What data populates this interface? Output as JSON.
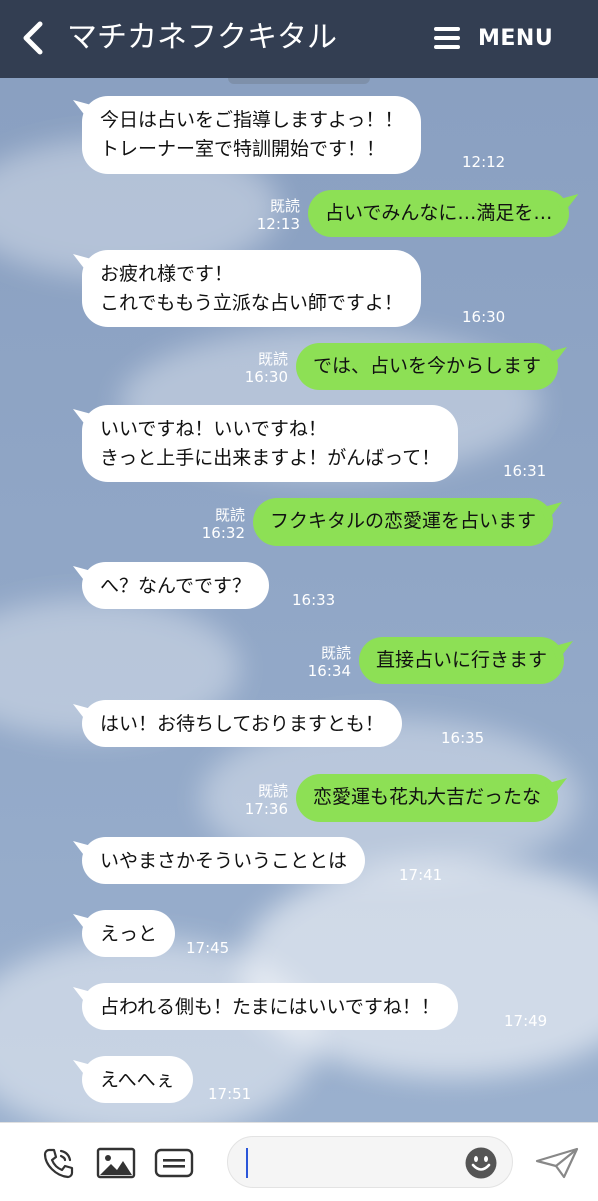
{
  "header": {
    "title": "マチカネフクキタル",
    "menu_label": "MENU"
  },
  "colors": {
    "header_bg": "#333e52",
    "outgoing_bubble": "#8de055",
    "incoming_bubble": "#ffffff",
    "chat_bg": "#8aa1c3"
  },
  "messages": [
    {
      "from": "them",
      "text": "今日は占いをご指導しますよっ！！\nトレーナー室で特訓開始です！！",
      "time": "12:12"
    },
    {
      "from": "me",
      "text": "占いでみんなに…満足を…",
      "read": "既読",
      "time": "12:13"
    },
    {
      "from": "them",
      "text": "お疲れ様です！\nこれでももう立派な占い師ですよ！",
      "time": "16:30"
    },
    {
      "from": "me",
      "text": "では、占いを今からします",
      "read": "既読",
      "time": "16:30"
    },
    {
      "from": "them",
      "text": "いいですね！いいですね！\nきっと上手に出来ますよ！がんばって！",
      "time": "16:31"
    },
    {
      "from": "me",
      "text": "フクキタルの恋愛運を占います",
      "read": "既読",
      "time": "16:32"
    },
    {
      "from": "them",
      "text": "へ？なんでです？",
      "time": "16:33"
    },
    {
      "from": "me",
      "text": "直接占いに行きます",
      "read": "既読",
      "time": "16:34"
    },
    {
      "from": "them",
      "text": "はい！お待ちしておりますとも！",
      "time": "16:35"
    },
    {
      "from": "me",
      "text": "恋愛運も花丸大吉だったな",
      "read": "既読",
      "time": "17:36"
    },
    {
      "from": "them",
      "text": "いやまさかそういうこととは",
      "time": "17:41"
    },
    {
      "from": "them",
      "text": "えっと",
      "time": "17:45"
    },
    {
      "from": "them",
      "text": "占われる側も！たまにはいいですね！！",
      "time": "17:49"
    },
    {
      "from": "them",
      "text": "えへへぇ",
      "time": "17:51"
    }
  ],
  "input": {
    "value": "",
    "icons": [
      "phone-icon",
      "image-icon",
      "keyboard-icon",
      "emoji-icon",
      "send-icon"
    ]
  }
}
